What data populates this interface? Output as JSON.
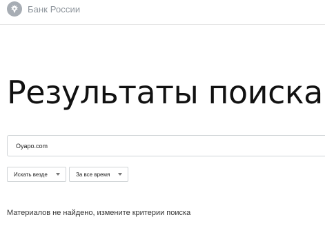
{
  "header": {
    "logo_text": "Банк России",
    "logo_icon": "eagle-emblem-icon"
  },
  "main": {
    "title": "Результаты поиска",
    "search": {
      "value": "Oyapo.com"
    },
    "filters": {
      "where": {
        "label": "Искать везде",
        "icon": "chevron-down-icon"
      },
      "time": {
        "label": "За все время",
        "icon": "chevron-down-icon"
      }
    },
    "empty_message": "Материалов не найдено, измените критерии поиска"
  },
  "colors": {
    "title": "#111111",
    "logo_text": "#8d949b",
    "border": "#cfd3d6"
  }
}
